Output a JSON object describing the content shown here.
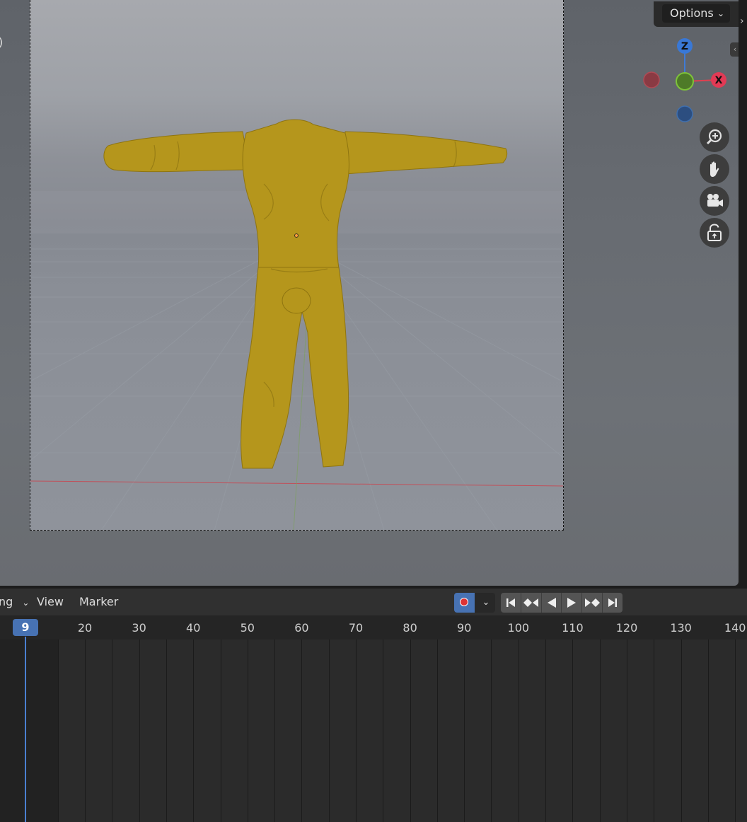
{
  "viewport": {
    "options_label": "Options",
    "left_edge_text": ")",
    "gizmo": {
      "z_label": "Z",
      "x_label": "X"
    },
    "nav_buttons": [
      "zoom-icon",
      "pan-hand-icon",
      "camera-view-icon",
      "lock-icon"
    ]
  },
  "timeline": {
    "mode_label": "ng",
    "view_label": "View",
    "marker_label": "Marker",
    "current_frame": "9",
    "frame_ticks": [
      "20",
      "30",
      "40",
      "50",
      "60",
      "70",
      "80",
      "90",
      "100",
      "110",
      "120",
      "130",
      "140"
    ],
    "colors": {
      "accent": "#4772b3",
      "record": "#dd3333"
    }
  }
}
